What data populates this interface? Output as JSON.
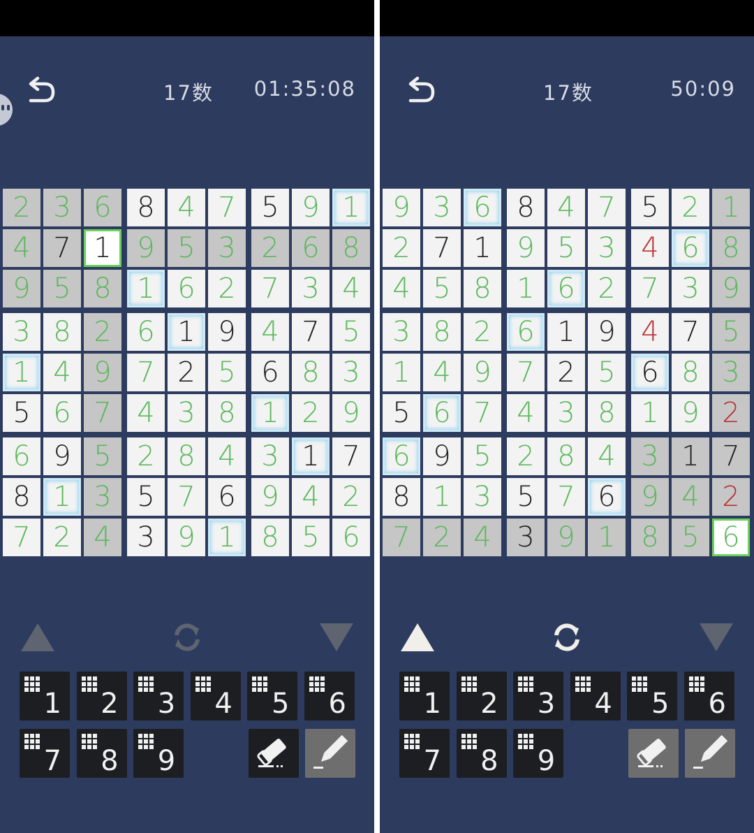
{
  "panels": [
    {
      "title": "17数",
      "timer": "01:35:08",
      "cells": [
        [
          {
            "v": "2",
            "c": "green",
            "s": 1
          },
          {
            "v": "3",
            "c": "green",
            "s": 1
          },
          {
            "v": "6",
            "c": "green",
            "s": 1
          },
          {
            "v": "8",
            "c": "black"
          },
          {
            "v": "4",
            "c": "green"
          },
          {
            "v": "7",
            "c": "green"
          },
          {
            "v": "5",
            "c": "black"
          },
          {
            "v": "9",
            "c": "green"
          },
          {
            "v": "1",
            "c": "green",
            "h": 1
          }
        ],
        [
          {
            "v": "4",
            "c": "green",
            "s": 1
          },
          {
            "v": "7",
            "c": "black",
            "s": 1
          },
          {
            "v": "1",
            "c": "black",
            "sel": 1
          },
          {
            "v": "9",
            "c": "green",
            "s": 1
          },
          {
            "v": "5",
            "c": "green",
            "s": 1
          },
          {
            "v": "3",
            "c": "green",
            "s": 1
          },
          {
            "v": "2",
            "c": "green",
            "s": 1
          },
          {
            "v": "6",
            "c": "green",
            "s": 1
          },
          {
            "v": "8",
            "c": "green",
            "s": 1
          }
        ],
        [
          {
            "v": "9",
            "c": "green",
            "s": 1
          },
          {
            "v": "5",
            "c": "green",
            "s": 1
          },
          {
            "v": "8",
            "c": "green",
            "s": 1
          },
          {
            "v": "1",
            "c": "green",
            "h": 1
          },
          {
            "v": "6",
            "c": "green"
          },
          {
            "v": "2",
            "c": "green"
          },
          {
            "v": "7",
            "c": "green"
          },
          {
            "v": "3",
            "c": "green"
          },
          {
            "v": "4",
            "c": "green"
          }
        ],
        [
          {
            "v": "3",
            "c": "green"
          },
          {
            "v": "8",
            "c": "green"
          },
          {
            "v": "2",
            "c": "green",
            "s": 1
          },
          {
            "v": "6",
            "c": "green"
          },
          {
            "v": "1",
            "c": "black",
            "h": 1
          },
          {
            "v": "9",
            "c": "black"
          },
          {
            "v": "4",
            "c": "green"
          },
          {
            "v": "7",
            "c": "black"
          },
          {
            "v": "5",
            "c": "green"
          }
        ],
        [
          {
            "v": "1",
            "c": "green",
            "h": 1
          },
          {
            "v": "4",
            "c": "green"
          },
          {
            "v": "9",
            "c": "green",
            "s": 1
          },
          {
            "v": "7",
            "c": "green"
          },
          {
            "v": "2",
            "c": "black"
          },
          {
            "v": "5",
            "c": "green"
          },
          {
            "v": "6",
            "c": "black"
          },
          {
            "v": "8",
            "c": "green"
          },
          {
            "v": "3",
            "c": "green"
          }
        ],
        [
          {
            "v": "5",
            "c": "black"
          },
          {
            "v": "6",
            "c": "green"
          },
          {
            "v": "7",
            "c": "green",
            "s": 1
          },
          {
            "v": "4",
            "c": "green"
          },
          {
            "v": "3",
            "c": "green"
          },
          {
            "v": "8",
            "c": "green"
          },
          {
            "v": "1",
            "c": "green",
            "h": 1
          },
          {
            "v": "2",
            "c": "green"
          },
          {
            "v": "9",
            "c": "green"
          }
        ],
        [
          {
            "v": "6",
            "c": "green"
          },
          {
            "v": "9",
            "c": "black"
          },
          {
            "v": "5",
            "c": "green",
            "s": 1
          },
          {
            "v": "2",
            "c": "green"
          },
          {
            "v": "8",
            "c": "green"
          },
          {
            "v": "4",
            "c": "green"
          },
          {
            "v": "3",
            "c": "green"
          },
          {
            "v": "1",
            "c": "black",
            "h": 1
          },
          {
            "v": "7",
            "c": "black"
          }
        ],
        [
          {
            "v": "8",
            "c": "black"
          },
          {
            "v": "1",
            "c": "green",
            "h": 1
          },
          {
            "v": "3",
            "c": "green",
            "s": 1
          },
          {
            "v": "5",
            "c": "black"
          },
          {
            "v": "7",
            "c": "green"
          },
          {
            "v": "6",
            "c": "black"
          },
          {
            "v": "9",
            "c": "green"
          },
          {
            "v": "4",
            "c": "green"
          },
          {
            "v": "2",
            "c": "green"
          }
        ],
        [
          {
            "v": "7",
            "c": "green"
          },
          {
            "v": "2",
            "c": "green"
          },
          {
            "v": "4",
            "c": "green",
            "s": 1
          },
          {
            "v": "3",
            "c": "black"
          },
          {
            "v": "9",
            "c": "green"
          },
          {
            "v": "1",
            "c": "green",
            "h": 1
          },
          {
            "v": "8",
            "c": "green"
          },
          {
            "v": "5",
            "c": "green"
          },
          {
            "v": "6",
            "c": "green"
          }
        ]
      ],
      "up_arrow_active": false,
      "eraser_style": "dark",
      "pencil_style": "gray",
      "show_edge_face": true
    },
    {
      "title": "17数",
      "timer": "50:09",
      "cells": [
        [
          {
            "v": "9",
            "c": "green"
          },
          {
            "v": "3",
            "c": "green"
          },
          {
            "v": "6",
            "c": "green",
            "h": 1
          },
          {
            "v": "8",
            "c": "black"
          },
          {
            "v": "4",
            "c": "green"
          },
          {
            "v": "7",
            "c": "green"
          },
          {
            "v": "5",
            "c": "black"
          },
          {
            "v": "2",
            "c": "green"
          },
          {
            "v": "1",
            "c": "green",
            "s": 1
          }
        ],
        [
          {
            "v": "2",
            "c": "green"
          },
          {
            "v": "7",
            "c": "black"
          },
          {
            "v": "1",
            "c": "black"
          },
          {
            "v": "9",
            "c": "green"
          },
          {
            "v": "5",
            "c": "green"
          },
          {
            "v": "3",
            "c": "green"
          },
          {
            "v": "4",
            "c": "red"
          },
          {
            "v": "6",
            "c": "green",
            "h": 1
          },
          {
            "v": "8",
            "c": "green",
            "s": 1
          }
        ],
        [
          {
            "v": "4",
            "c": "green"
          },
          {
            "v": "5",
            "c": "green"
          },
          {
            "v": "8",
            "c": "green"
          },
          {
            "v": "1",
            "c": "green"
          },
          {
            "v": "6",
            "c": "green",
            "h": 1
          },
          {
            "v": "2",
            "c": "green"
          },
          {
            "v": "7",
            "c": "green"
          },
          {
            "v": "3",
            "c": "green"
          },
          {
            "v": "9",
            "c": "green",
            "s": 1
          }
        ],
        [
          {
            "v": "3",
            "c": "green"
          },
          {
            "v": "8",
            "c": "green"
          },
          {
            "v": "2",
            "c": "green"
          },
          {
            "v": "6",
            "c": "green",
            "h": 1
          },
          {
            "v": "1",
            "c": "black"
          },
          {
            "v": "9",
            "c": "black"
          },
          {
            "v": "4",
            "c": "red"
          },
          {
            "v": "7",
            "c": "black"
          },
          {
            "v": "5",
            "c": "green",
            "s": 1
          }
        ],
        [
          {
            "v": "1",
            "c": "green"
          },
          {
            "v": "4",
            "c": "green"
          },
          {
            "v": "9",
            "c": "green"
          },
          {
            "v": "7",
            "c": "green"
          },
          {
            "v": "2",
            "c": "black"
          },
          {
            "v": "5",
            "c": "green"
          },
          {
            "v": "6",
            "c": "black",
            "h": 1
          },
          {
            "v": "8",
            "c": "green"
          },
          {
            "v": "3",
            "c": "green",
            "s": 1
          }
        ],
        [
          {
            "v": "5",
            "c": "black"
          },
          {
            "v": "6",
            "c": "green",
            "h": 1
          },
          {
            "v": "7",
            "c": "green"
          },
          {
            "v": "4",
            "c": "green"
          },
          {
            "v": "3",
            "c": "green"
          },
          {
            "v": "8",
            "c": "green"
          },
          {
            "v": "1",
            "c": "green"
          },
          {
            "v": "9",
            "c": "green"
          },
          {
            "v": "2",
            "c": "red",
            "s": 1
          }
        ],
        [
          {
            "v": "6",
            "c": "green",
            "h": 1
          },
          {
            "v": "9",
            "c": "black"
          },
          {
            "v": "5",
            "c": "green"
          },
          {
            "v": "2",
            "c": "green"
          },
          {
            "v": "8",
            "c": "green"
          },
          {
            "v": "4",
            "c": "green"
          },
          {
            "v": "3",
            "c": "green",
            "s": 1
          },
          {
            "v": "1",
            "c": "black",
            "s": 1
          },
          {
            "v": "7",
            "c": "black",
            "s": 1
          }
        ],
        [
          {
            "v": "8",
            "c": "black"
          },
          {
            "v": "1",
            "c": "green"
          },
          {
            "v": "3",
            "c": "green"
          },
          {
            "v": "5",
            "c": "black"
          },
          {
            "v": "7",
            "c": "green"
          },
          {
            "v": "6",
            "c": "black",
            "h": 1
          },
          {
            "v": "9",
            "c": "green",
            "s": 1
          },
          {
            "v": "4",
            "c": "green",
            "s": 1
          },
          {
            "v": "2",
            "c": "red",
            "s": 1
          }
        ],
        [
          {
            "v": "7",
            "c": "green",
            "s": 1
          },
          {
            "v": "2",
            "c": "green",
            "s": 1
          },
          {
            "v": "4",
            "c": "green",
            "s": 1
          },
          {
            "v": "3",
            "c": "black",
            "s": 1
          },
          {
            "v": "9",
            "c": "green",
            "s": 1
          },
          {
            "v": "1",
            "c": "green",
            "s": 1
          },
          {
            "v": "8",
            "c": "green",
            "s": 1
          },
          {
            "v": "5",
            "c": "green",
            "s": 1
          },
          {
            "v": "6",
            "c": "green",
            "sel": 1
          }
        ]
      ],
      "up_arrow_active": true,
      "eraser_style": "gray",
      "pencil_style": "gray",
      "show_edge_face": false
    }
  ],
  "keypad": [
    "1",
    "2",
    "3",
    "4",
    "5",
    "6",
    "7",
    "8",
    "9"
  ],
  "colors": {
    "background": "#2d3b5f",
    "digit_green": "#5cb85c",
    "digit_black": "#222222",
    "digit_red": "#b83232",
    "cell": "#f3f3f3",
    "cell_shaded": "#c6c6c6",
    "highlight": "#8dd2ef",
    "selected": "#6ad15a",
    "key": "#1c1e22"
  },
  "icons": {
    "back": "undo-arrow-icon",
    "rotate": "rotate-arrows-icon",
    "up": "triangle-up-icon",
    "down": "triangle-down-icon",
    "eraser": "eraser-icon",
    "pencil": "pencil-icon",
    "memo_dots": "grid-dots-icon"
  }
}
